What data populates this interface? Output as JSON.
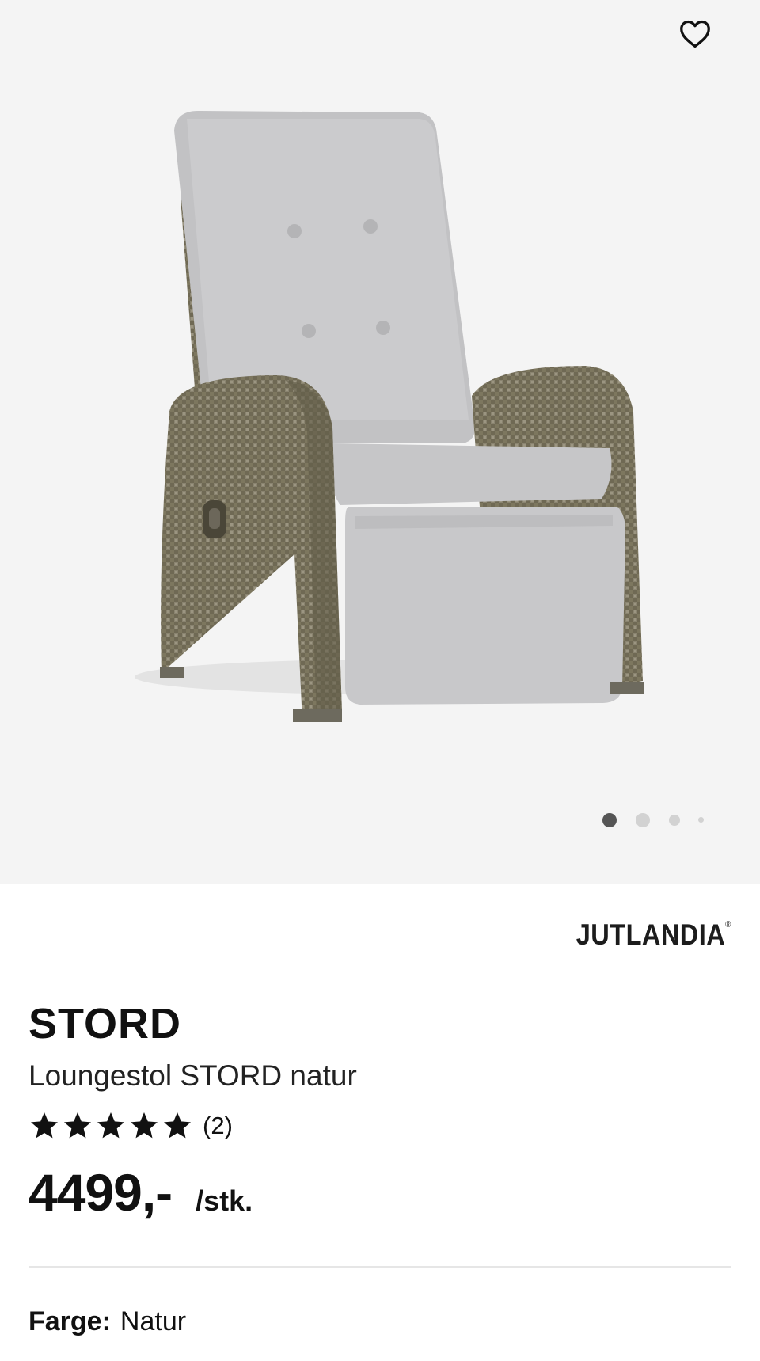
{
  "gallery": {
    "image": "recliner-chair-rattan-grey-cushion",
    "favorite_icon": "heart-outline-icon",
    "slide_count": 4,
    "active_slide": 1
  },
  "brand": {
    "name": "JUTLANDIA",
    "registered_mark": "®"
  },
  "product": {
    "title": "STORD",
    "subtitle": "Loungestol STORD natur",
    "rating": {
      "stars": 5,
      "count_label": "(2)"
    },
    "price": "4499,-",
    "unit": "/stk."
  },
  "variant": {
    "color_label": "Farge:",
    "color_value": "Natur"
  },
  "colors": {
    "background_gallery": "#f4f4f4",
    "text": "#111111",
    "dot_active": "#555555",
    "dot_inactive": "#d2d2d2"
  }
}
